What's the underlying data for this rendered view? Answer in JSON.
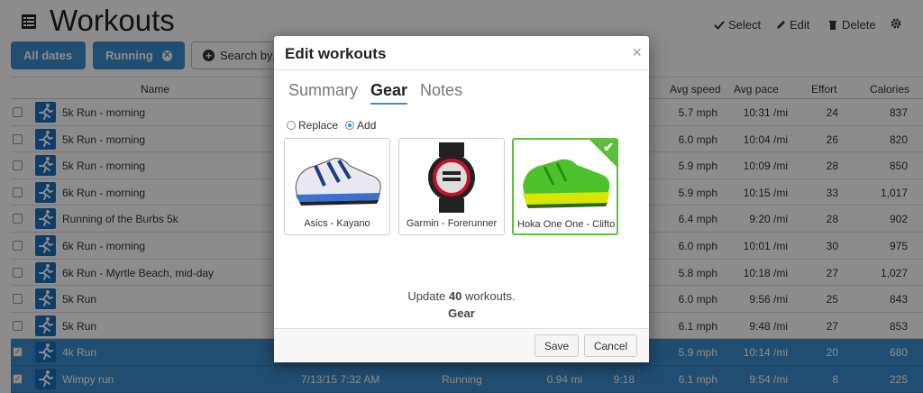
{
  "header": {
    "title": "Workouts",
    "toolbar": {
      "select": "Select",
      "edit": "Edit",
      "delete": "Delete"
    }
  },
  "filters": {
    "chips": [
      "All dates",
      "Running"
    ],
    "search_placeholder": "Search by..."
  },
  "table": {
    "columns": [
      "Name",
      "Avg speed",
      "Avg pace",
      "Effort",
      "Calories"
    ],
    "rows": [
      {
        "name": "5k Run - morning",
        "date": "",
        "type": "",
        "dist": "",
        "time": "",
        "speed": "5.7 mph",
        "pace": "10:31 /mi",
        "effort": "24",
        "cal": "837",
        "selected": false
      },
      {
        "name": "5k Run - morning",
        "date": "",
        "type": "",
        "dist": "",
        "time": "",
        "speed": "6.0 mph",
        "pace": "10:04 /mi",
        "effort": "26",
        "cal": "820",
        "selected": false
      },
      {
        "name": "5k Run - morning",
        "date": "",
        "type": "",
        "dist": "",
        "time": "",
        "speed": "5.9 mph",
        "pace": "10:09 /mi",
        "effort": "28",
        "cal": "850",
        "selected": false
      },
      {
        "name": "6k Run - morning",
        "date": "",
        "type": "",
        "dist": "",
        "time": "",
        "speed": "5.9 mph",
        "pace": "10:15 /mi",
        "effort": "33",
        "cal": "1,017",
        "selected": false
      },
      {
        "name": "Running of the Burbs 5k",
        "date": "",
        "type": "",
        "dist": "",
        "time": "",
        "speed": "6.4 mph",
        "pace": "9:20 /mi",
        "effort": "28",
        "cal": "902",
        "selected": false
      },
      {
        "name": "6k Run - morning",
        "date": "",
        "type": "",
        "dist": "",
        "time": "",
        "speed": "6.0 mph",
        "pace": "10:01 /mi",
        "effort": "30",
        "cal": "975",
        "selected": false
      },
      {
        "name": "6k Run - Myrtle Beach, mid-day",
        "date": "",
        "type": "",
        "dist": "",
        "time": "",
        "speed": "5.8 mph",
        "pace": "10:18 /mi",
        "effort": "27",
        "cal": "1,027",
        "selected": false
      },
      {
        "name": "5k Run",
        "date": "",
        "type": "",
        "dist": "",
        "time": "",
        "speed": "6.0 mph",
        "pace": "9:56 /mi",
        "effort": "25",
        "cal": "843",
        "selected": false
      },
      {
        "name": "5k Run",
        "date": "",
        "type": "",
        "dist": "",
        "time": "",
        "speed": "6.1 mph",
        "pace": "9:48 /mi",
        "effort": "27",
        "cal": "853",
        "selected": false
      },
      {
        "name": "4k Run",
        "date": "",
        "type": "",
        "dist": "",
        "time": "",
        "speed": "5.9 mph",
        "pace": "10:14 /mi",
        "effort": "20",
        "cal": "680",
        "selected": true
      },
      {
        "name": "Wimpy run",
        "date": "7/13/15 7:32 AM",
        "type": "Running",
        "dist": "0.94 mi",
        "time": "9:18",
        "speed": "6.1 mph",
        "pace": "9:54 /mi",
        "effort": "8",
        "cal": "225",
        "selected": true
      }
    ]
  },
  "modal": {
    "title": "Edit workouts",
    "close": "×",
    "tabs": [
      "Summary",
      "Gear",
      "Notes"
    ],
    "active_tab": "Gear",
    "radio_options": [
      "Replace",
      "Add"
    ],
    "radio_selected": "Add",
    "gear": [
      {
        "label": "Asics - Kayano",
        "icon": "running-shoe-blue-icon",
        "selected": false
      },
      {
        "label": "Garmin - Forerunner",
        "icon": "gps-watch-icon",
        "selected": false
      },
      {
        "label": "Hoka One One - Clifton",
        "icon": "running-shoe-green-icon",
        "selected": true
      }
    ],
    "update_prefix": "Update ",
    "update_count": "40",
    "update_suffix": " workouts.",
    "update_subject": "Gear",
    "save": "Save",
    "cancel": "Cancel"
  },
  "colors": {
    "accent": "#3b8fd0",
    "selected_gear": "#5cbf3c",
    "row_icon": "#1d6fc2"
  }
}
